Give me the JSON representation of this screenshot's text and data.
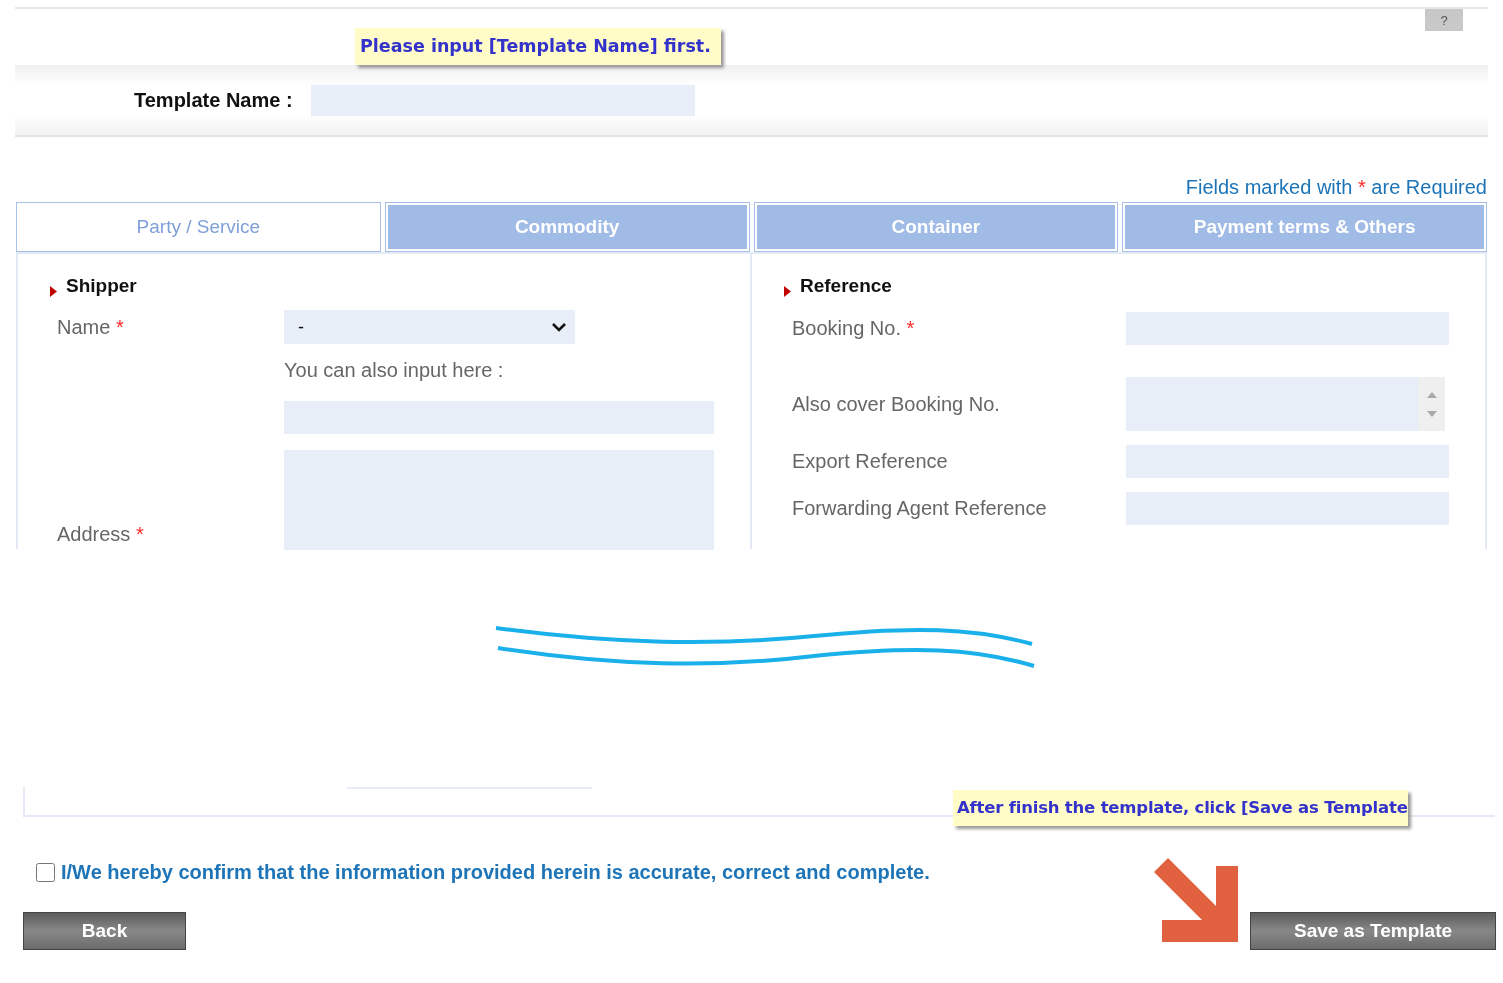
{
  "help_button": {
    "label": "?"
  },
  "callouts": [
    {
      "text": "Please input [Template Name] first."
    },
    {
      "text": "After finish the template, click [Save as Template"
    }
  ],
  "template_name": {
    "label": "Template Name :"
  },
  "required_note": {
    "before": "Fields marked with",
    "mark": "*",
    "after": "are Required"
  },
  "tabs": [
    {
      "label": "Party / Service",
      "selected": true
    },
    {
      "label": "Commodity",
      "selected": false
    },
    {
      "label": "Container",
      "selected": false
    },
    {
      "label": "Payment terms & Others",
      "selected": false
    }
  ],
  "shipper": {
    "heading": "Shipper",
    "name_label": "Name",
    "name_mark": "*",
    "name_value": "-",
    "also_input_label": "You can also input here :",
    "address_label": "Address",
    "address_mark": "*"
  },
  "reference": {
    "heading": "Reference",
    "fields": [
      {
        "label": "Booking No.",
        "mark": "*",
        "kind": "text"
      },
      {
        "label": "Also cover Booking No.",
        "kind": "spin"
      },
      {
        "label": "Export Reference",
        "kind": "text"
      },
      {
        "label": "Forwarding Agent Reference",
        "kind": "text"
      }
    ]
  },
  "confirm": {
    "checked": false,
    "text": "I/We hereby confirm that the information provided herein is accurate, correct and complete."
  },
  "buttons": [
    {
      "label": "Back"
    },
    {
      "label": "Save as Template"
    }
  ]
}
